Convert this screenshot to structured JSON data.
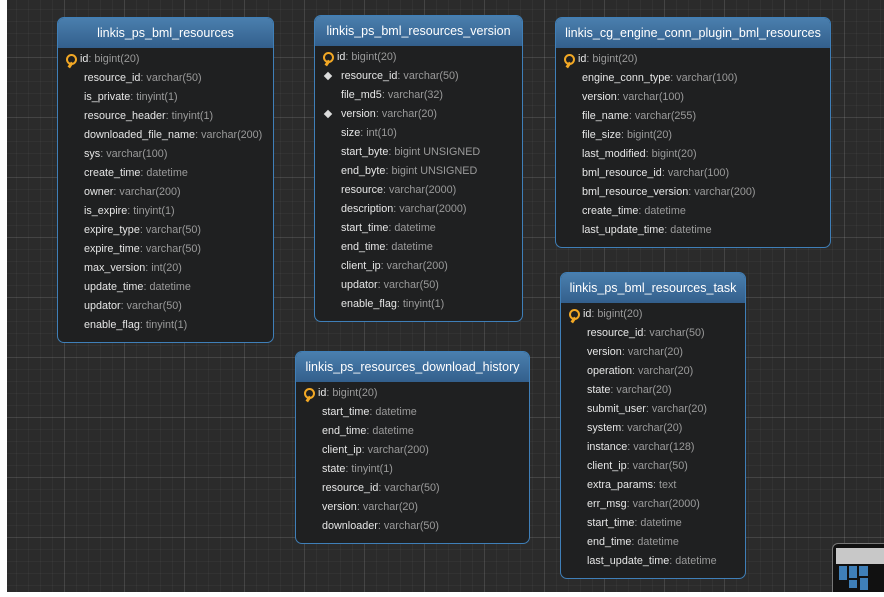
{
  "tables": [
    {
      "name": "linkis_ps_bml_resources",
      "columns": [
        {
          "name": "id",
          "type": "bigint(20)",
          "mark": "key"
        },
        {
          "name": "resource_id",
          "type": "varchar(50)",
          "mark": ""
        },
        {
          "name": "is_private",
          "type": "tinyint(1)",
          "mark": ""
        },
        {
          "name": "resource_header",
          "type": "tinyint(1)",
          "mark": ""
        },
        {
          "name": "downloaded_file_name",
          "type": "varchar(200)",
          "mark": ""
        },
        {
          "name": "sys",
          "type": "varchar(100)",
          "mark": ""
        },
        {
          "name": "create_time",
          "type": "datetime",
          "mark": ""
        },
        {
          "name": "owner",
          "type": "varchar(200)",
          "mark": ""
        },
        {
          "name": "is_expire",
          "type": "tinyint(1)",
          "mark": ""
        },
        {
          "name": "expire_type",
          "type": "varchar(50)",
          "mark": ""
        },
        {
          "name": "expire_time",
          "type": "varchar(50)",
          "mark": ""
        },
        {
          "name": "max_version",
          "type": "int(20)",
          "mark": ""
        },
        {
          "name": "update_time",
          "type": "datetime",
          "mark": ""
        },
        {
          "name": "updator",
          "type": "varchar(50)",
          "mark": ""
        },
        {
          "name": "enable_flag",
          "type": "tinyint(1)",
          "mark": ""
        }
      ]
    },
    {
      "name": "linkis_ps_bml_resources_version",
      "columns": [
        {
          "name": "id",
          "type": "bigint(20)",
          "mark": "key"
        },
        {
          "name": "resource_id",
          "type": "varchar(50)",
          "mark": "index"
        },
        {
          "name": "file_md5",
          "type": "varchar(32)",
          "mark": ""
        },
        {
          "name": "version",
          "type": "varchar(20)",
          "mark": "index"
        },
        {
          "name": "size",
          "type": "int(10)",
          "mark": ""
        },
        {
          "name": "start_byte",
          "type": "bigint UNSIGNED",
          "mark": ""
        },
        {
          "name": "end_byte",
          "type": "bigint UNSIGNED",
          "mark": ""
        },
        {
          "name": "resource",
          "type": "varchar(2000)",
          "mark": ""
        },
        {
          "name": "description",
          "type": "varchar(2000)",
          "mark": ""
        },
        {
          "name": "start_time",
          "type": "datetime",
          "mark": ""
        },
        {
          "name": "end_time",
          "type": "datetime",
          "mark": ""
        },
        {
          "name": "client_ip",
          "type": "varchar(200)",
          "mark": ""
        },
        {
          "name": "updator",
          "type": "varchar(50)",
          "mark": ""
        },
        {
          "name": "enable_flag",
          "type": "tinyint(1)",
          "mark": ""
        }
      ]
    },
    {
      "name": "linkis_cg_engine_conn_plugin_bml_resources",
      "columns": [
        {
          "name": "id",
          "type": "bigint(20)",
          "mark": "key"
        },
        {
          "name": "engine_conn_type",
          "type": "varchar(100)",
          "mark": ""
        },
        {
          "name": "version",
          "type": "varchar(100)",
          "mark": ""
        },
        {
          "name": "file_name",
          "type": "varchar(255)",
          "mark": ""
        },
        {
          "name": "file_size",
          "type": "bigint(20)",
          "mark": ""
        },
        {
          "name": "last_modified",
          "type": "bigint(20)",
          "mark": ""
        },
        {
          "name": "bml_resource_id",
          "type": "varchar(100)",
          "mark": ""
        },
        {
          "name": "bml_resource_version",
          "type": "varchar(200)",
          "mark": ""
        },
        {
          "name": "create_time",
          "type": "datetime",
          "mark": ""
        },
        {
          "name": "last_update_time",
          "type": "datetime",
          "mark": ""
        }
      ]
    },
    {
      "name": "linkis_ps_resources_download_history",
      "columns": [
        {
          "name": "id",
          "type": "bigint(20)",
          "mark": "key"
        },
        {
          "name": "start_time",
          "type": "datetime",
          "mark": ""
        },
        {
          "name": "end_time",
          "type": "datetime",
          "mark": ""
        },
        {
          "name": "client_ip",
          "type": "varchar(200)",
          "mark": ""
        },
        {
          "name": "state",
          "type": "tinyint(1)",
          "mark": ""
        },
        {
          "name": "resource_id",
          "type": "varchar(50)",
          "mark": ""
        },
        {
          "name": "version",
          "type": "varchar(20)",
          "mark": ""
        },
        {
          "name": "downloader",
          "type": "varchar(50)",
          "mark": ""
        }
      ]
    },
    {
      "name": "linkis_ps_bml_resources_task",
      "columns": [
        {
          "name": "id",
          "type": "bigint(20)",
          "mark": "key"
        },
        {
          "name": "resource_id",
          "type": "varchar(50)",
          "mark": ""
        },
        {
          "name": "version",
          "type": "varchar(20)",
          "mark": ""
        },
        {
          "name": "operation",
          "type": "varchar(20)",
          "mark": ""
        },
        {
          "name": "state",
          "type": "varchar(20)",
          "mark": ""
        },
        {
          "name": "submit_user",
          "type": "varchar(20)",
          "mark": ""
        },
        {
          "name": "system",
          "type": "varchar(20)",
          "mark": ""
        },
        {
          "name": "instance",
          "type": "varchar(128)",
          "mark": ""
        },
        {
          "name": "client_ip",
          "type": "varchar(50)",
          "mark": ""
        },
        {
          "name": "extra_params",
          "type": "text",
          "mark": ""
        },
        {
          "name": "err_msg",
          "type": "varchar(2000)",
          "mark": ""
        },
        {
          "name": "start_time",
          "type": "datetime",
          "mark": ""
        },
        {
          "name": "end_time",
          "type": "datetime",
          "mark": ""
        },
        {
          "name": "last_update_time",
          "type": "datetime",
          "mark": ""
        }
      ]
    }
  ],
  "colors": {
    "canvas": "#2b2b2b",
    "table_border": "#3f7fb8",
    "primary_key_icon": "#f2a825",
    "column_type_text": "#9a9a9a"
  }
}
